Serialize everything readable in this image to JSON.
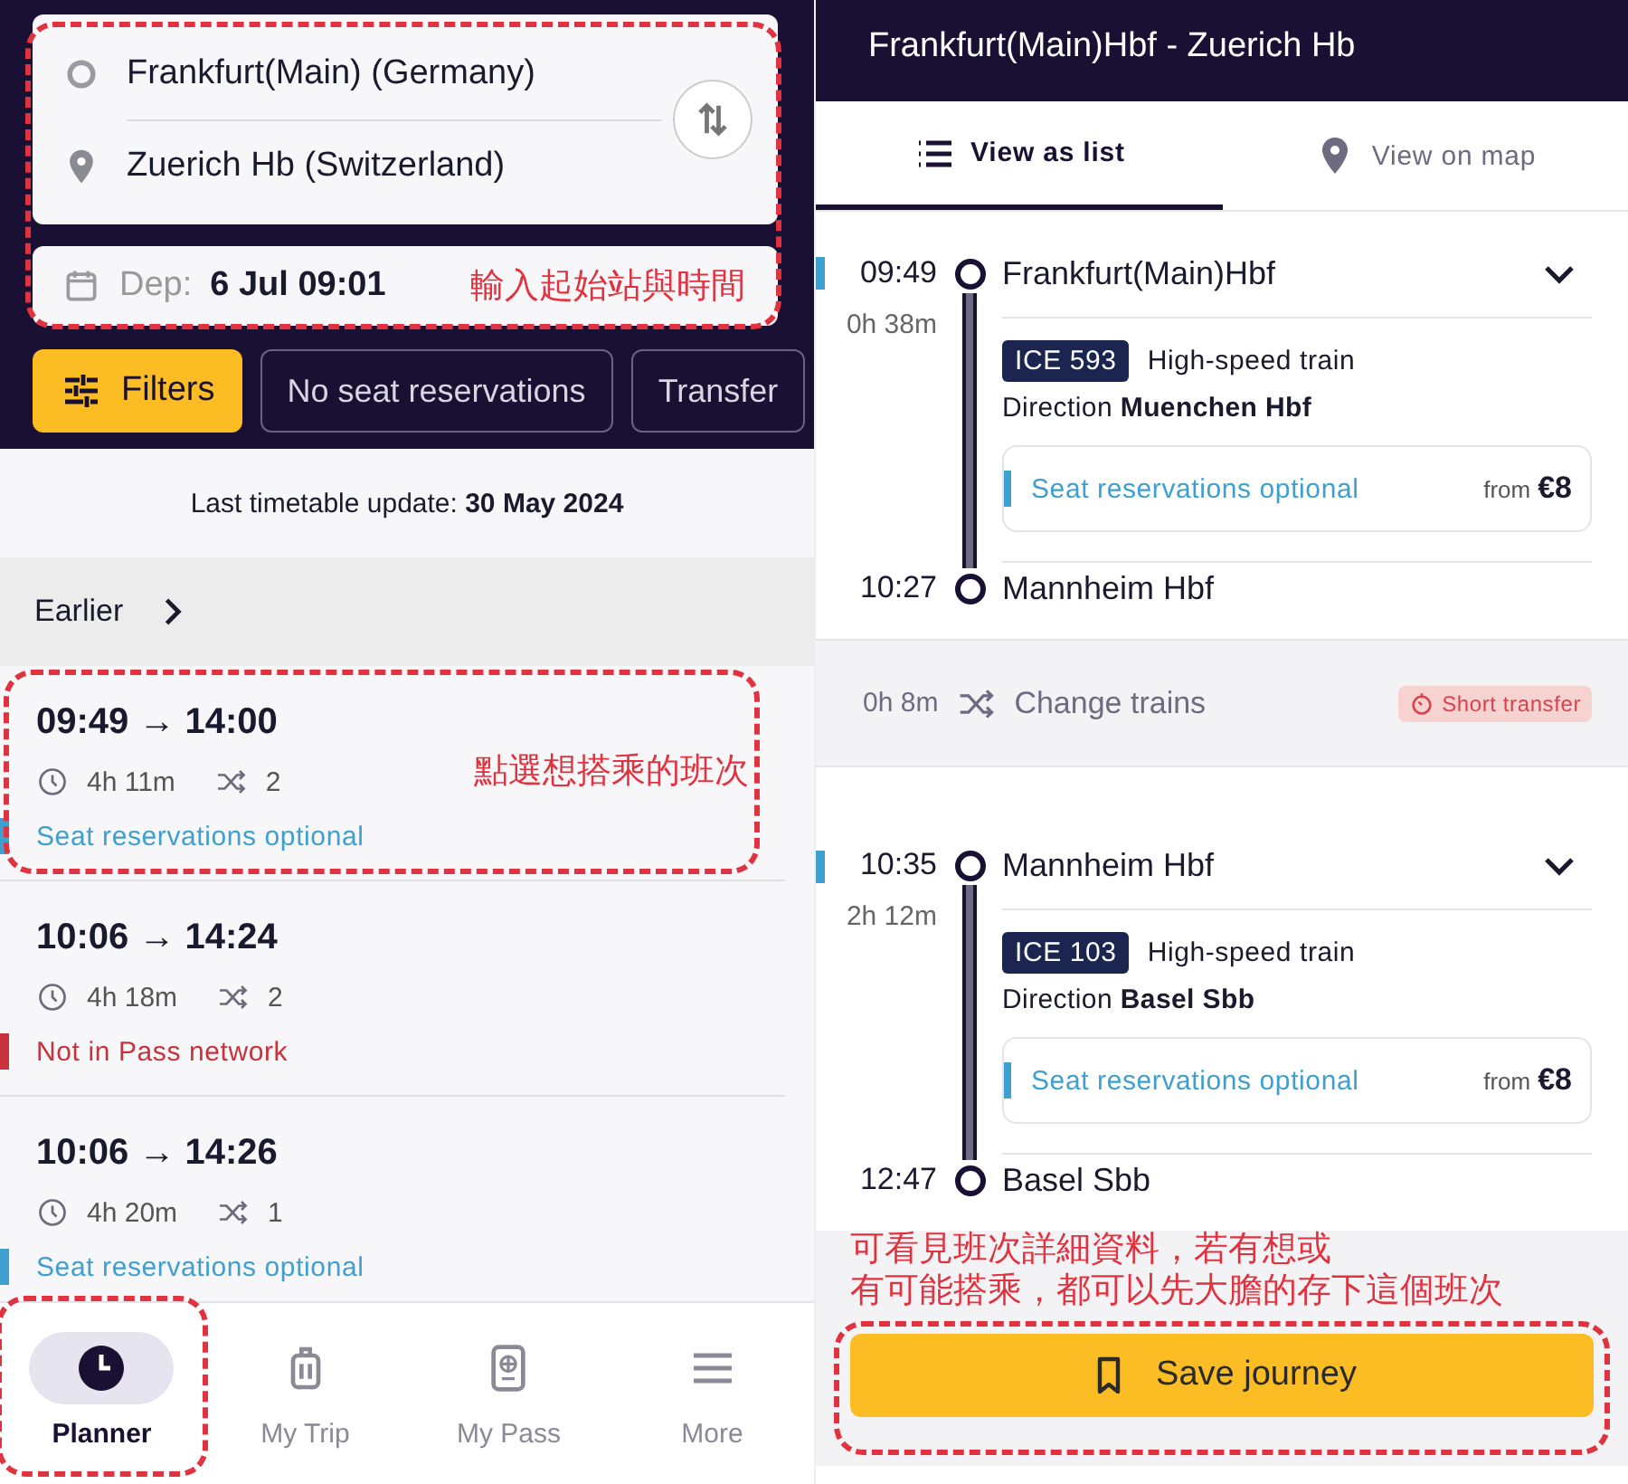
{
  "planner": {
    "origin": "Frankfurt(Main) (Germany)",
    "destination": "Zuerich Hb (Switzerland)",
    "departure": {
      "label": "Dep:",
      "value": "6 Jul 09:01"
    },
    "route_annotation": "輸入起始站與時間",
    "filters": [
      {
        "label": "Filters",
        "kind": "primary"
      },
      {
        "label": "No seat reservations",
        "kind": "chip"
      },
      {
        "label": "Transfer",
        "kind": "chip"
      }
    ],
    "update": {
      "label": "Last timetable update:",
      "value": "30 May 2024"
    },
    "earlier": "Earlier",
    "journeys": [
      {
        "times": "09:49 → 14:00",
        "duration": "4h 11m",
        "transfers": "2",
        "note": "Seat reservations optional",
        "color": "#3f9fcf",
        "annotation": "點選想搭乘的班次"
      },
      {
        "times": "10:06 → 14:24",
        "duration": "4h 18m",
        "transfers": "2",
        "note": "Not in Pass network",
        "color": "#c8323c"
      },
      {
        "times": "10:06 → 14:26",
        "duration": "4h 20m",
        "transfers": "1",
        "note": "Seat reservations optional",
        "color": "#3f9fcf"
      }
    ],
    "nav": [
      {
        "label": "Planner",
        "selected": true,
        "annotated": true
      },
      {
        "label": "My Trip",
        "selected": false,
        "annotated": false
      },
      {
        "label": "My Pass",
        "selected": false,
        "annotated": false
      },
      {
        "label": "More",
        "selected": false,
        "annotated": false
      }
    ]
  },
  "details": {
    "title": "Frankfurt(Main)Hbf - Zuerich Hb",
    "tabs": [
      {
        "label": "View as list",
        "selected": true
      },
      {
        "label": "View on map",
        "selected": false
      }
    ],
    "segments": [
      {
        "kind": "leg",
        "dep_time": "09:49",
        "duration": "0h 38m",
        "from": "Frankfurt(Main)Hbf",
        "train": "ICE 593",
        "train_type": "High-speed train",
        "direction_label": "Direction",
        "direction": "Muenchen Hbf",
        "reservation": "Seat reservations optional",
        "price_label": "from",
        "price": "€8",
        "arr_time": "10:27",
        "to": "Mannheim Hbf"
      },
      {
        "kind": "change",
        "duration": "0h  8m",
        "label": "Change trains",
        "badge": "Short transfer"
      },
      {
        "kind": "leg",
        "dep_time": "10:35",
        "duration": "2h 12m",
        "from": "Mannheim Hbf",
        "train": "ICE 103",
        "train_type": "High-speed train",
        "direction_label": "Direction",
        "direction": "Basel Sbb",
        "reservation": "Seat reservations optional",
        "price_label": "from",
        "price": "€8",
        "arr_time": "12:47",
        "to": "Basel Sbb"
      }
    ],
    "save_annotation": [
      "可看見班次詳細資料，若有想或",
      "有可能搭乘，都可以先大膽的存下這個班次"
    ],
    "save": "Save journey"
  }
}
